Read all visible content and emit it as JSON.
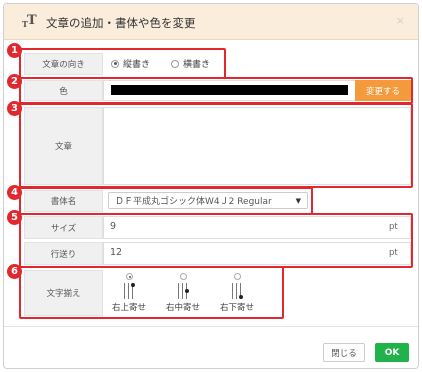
{
  "dialog": {
    "title": "文章の追加・書体や色を変更",
    "close_glyph": "×"
  },
  "badges": [
    "1",
    "2",
    "3",
    "4",
    "5",
    "6"
  ],
  "direction": {
    "label": "文章の向き",
    "options": [
      {
        "label": "縦書き",
        "selected": true
      },
      {
        "label": "横書き",
        "selected": false
      }
    ]
  },
  "color": {
    "label": "色",
    "swatch": "#000000",
    "change_button": "変更する",
    "accent": "#f39b3c"
  },
  "text": {
    "label": "文章",
    "value": ""
  },
  "font": {
    "label": "書体名",
    "selected": "ＤＦ平成丸ゴシック体W4Ｊ2 Regular",
    "caret": "▼"
  },
  "size": {
    "label": "サイズ",
    "value": "9",
    "unit": "pt"
  },
  "leading": {
    "label": "行送り",
    "value": "12",
    "unit": "pt"
  },
  "alignment": {
    "label": "文字揃え",
    "options": [
      {
        "label": "右上寄せ",
        "selected": true
      },
      {
        "label": "右中寄せ",
        "selected": false
      },
      {
        "label": "右下寄せ",
        "selected": false
      }
    ]
  },
  "footer": {
    "close_button": "閉じる",
    "ok_button": "OK",
    "ok_color": "#22b24c"
  },
  "annotation_color": "#e0282e"
}
